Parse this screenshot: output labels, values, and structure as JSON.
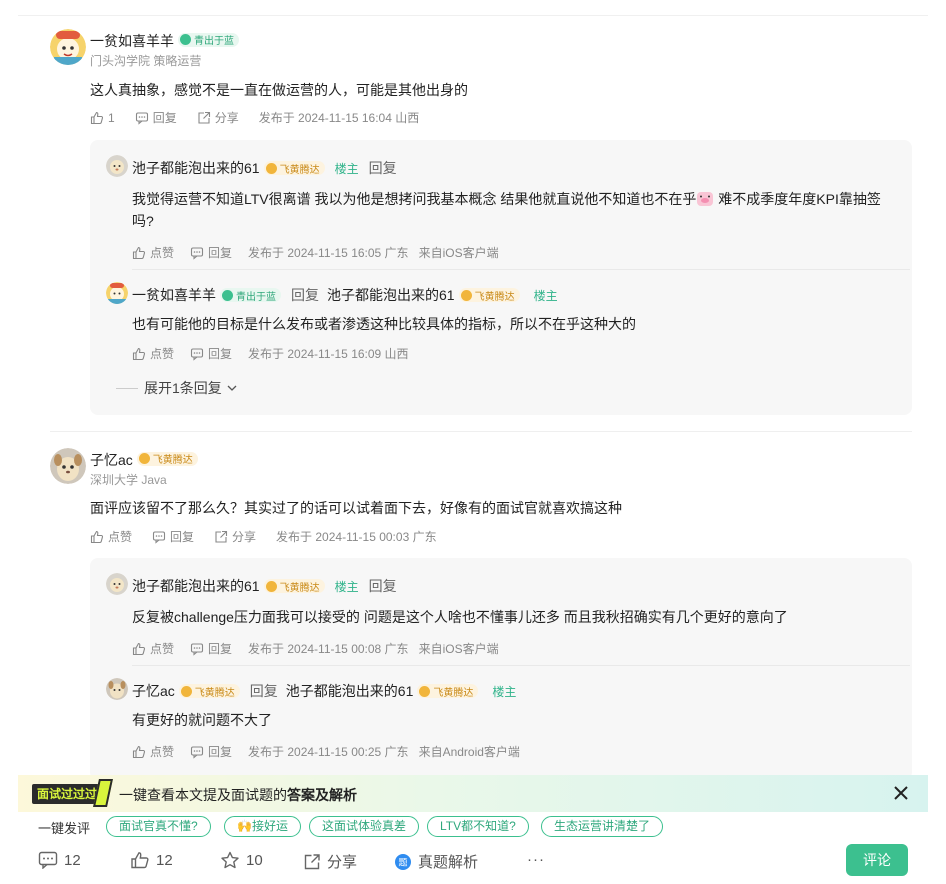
{
  "comments": [
    {
      "user": "一贫如喜羊羊",
      "badge": "青出于蓝",
      "sub": "门头沟学院 策略运营",
      "text": "这人真抽象，感觉不是一直在做运营的人，可能是其他出身的",
      "like": "1",
      "reply_label": "回复",
      "share_label": "分享",
      "meta": "发布于 2024-11-15 16:04 山西",
      "replies": [
        {
          "user": "池子都能泡出来的61",
          "badge": "飞黄腾达",
          "louzhu": "楼主",
          "reply_word": "回复",
          "text_a": "我觉得运营不知道LTV很离谱 我以为他是想拷问我基本概念 结果他就直说他不知道也不在乎",
          "text_b": " 难不成季度年度KPI靠抽签",
          "text_c": "吗?",
          "like": "点赞",
          "reply_label": "回复",
          "meta": "发布于 2024-11-15 16:05 广东",
          "client": "来自iOS客户端"
        },
        {
          "user": "一贫如喜羊羊",
          "badge": "青出于蓝",
          "reply_word": "回复",
          "target": "池子都能泡出来的61",
          "target_badge": "飞黄腾达",
          "louzhu": "楼主",
          "text": "也有可能他的目标是什么发布或者渗透这种比较具体的指标，所以不在乎这种大的",
          "like": "点赞",
          "reply_label": "回复",
          "meta": "发布于 2024-11-15 16:09 山西"
        }
      ],
      "expand": "展开1条回复"
    },
    {
      "user": "子忆ac",
      "badge": "飞黄腾达",
      "sub": "深圳大学 Java",
      "text": "面评应该留不了那么久？其实过了的话可以试着面下去，好像有的面试官就喜欢搞这种",
      "like": "点赞",
      "reply_label": "回复",
      "share_label": "分享",
      "meta": "发布于 2024-11-15 00:03 广东",
      "replies": [
        {
          "user": "池子都能泡出来的61",
          "badge": "飞黄腾达",
          "louzhu": "楼主",
          "reply_word": "回复",
          "text": "反复被challenge压力面我可以接受的 问题是这个人啥也不懂事儿还多 而且我秋招确实有几个更好的意向了",
          "like": "点赞",
          "reply_label": "回复",
          "meta": "发布于 2024-11-15 00:08 广东",
          "client": "来自iOS客户端"
        },
        {
          "user": "子忆ac",
          "badge": "飞黄腾达",
          "reply_word": "回复",
          "target": "池子都能泡出来的61",
          "target_badge": "飞黄腾达",
          "louzhu": "楼主",
          "text": "有更好的就问题不大了",
          "like": "点赞",
          "reply_label": "回复",
          "meta": "发布于 2024-11-15 00:25 广东",
          "client": "来自Android客户端"
        }
      ]
    }
  ],
  "banner": {
    "tag": "面试过过过",
    "text_a": "一键查看本文提及面试题的",
    "text_b": "答案及解析"
  },
  "quick": {
    "label": "一键发评",
    "chips": [
      "面试官真不懂?",
      "🙌接好运",
      "这面试体验真差",
      "LTV都不知道?",
      "生态运营讲清楚了"
    ]
  },
  "bottom": {
    "comments": "12",
    "likes": "12",
    "stars": "10",
    "share": "分享",
    "analysis": "真题解析",
    "more": "···",
    "comment_btn": "评论"
  },
  "colors": {
    "accent": "#3cc08f",
    "badge_green": "#2ea77a",
    "badge_gold": "#c98a18"
  }
}
